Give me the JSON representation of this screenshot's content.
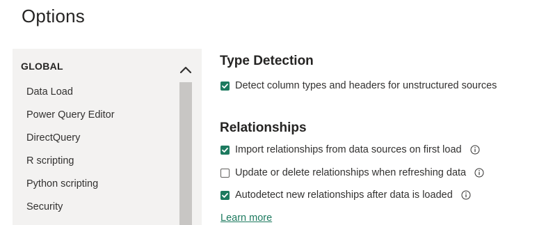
{
  "page": {
    "title": "Options"
  },
  "sidebar": {
    "header": "GLOBAL",
    "items": [
      {
        "label": "Data Load"
      },
      {
        "label": "Power Query Editor"
      },
      {
        "label": "DirectQuery"
      },
      {
        "label": "R scripting"
      },
      {
        "label": "Python scripting"
      },
      {
        "label": "Security"
      }
    ]
  },
  "type_detection": {
    "title": "Type Detection",
    "options": [
      {
        "label": "Detect column types and headers for unstructured sources",
        "checked": true
      }
    ]
  },
  "relationships": {
    "title": "Relationships",
    "options": [
      {
        "label": "Import relationships from data sources on first load",
        "checked": true,
        "info": true
      },
      {
        "label": "Update or delete relationships when refreshing data",
        "checked": false,
        "info": true
      },
      {
        "label": "Autodetect new relationships after data is loaded",
        "checked": true,
        "info": true
      }
    ],
    "learn_more": "Learn more"
  },
  "colors": {
    "accent": "#1d7a5f",
    "sidebar_bg": "#f3f2f1",
    "scrollbar": "#c8c6c4"
  },
  "icons": {
    "scroll_up": "chevron-up-icon",
    "info": "info-icon",
    "check": "checkmark-icon"
  }
}
